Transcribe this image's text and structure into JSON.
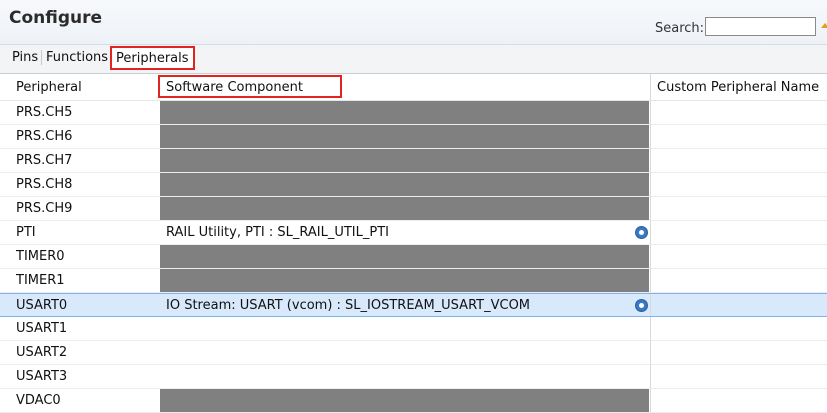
{
  "header": {
    "title": "Configure",
    "search_label": "Search:",
    "search_value": ""
  },
  "tabs": [
    {
      "label": "Pins",
      "active": false
    },
    {
      "label": "Functions",
      "active": false
    },
    {
      "label": "Peripherals",
      "active": true
    }
  ],
  "table": {
    "columns": [
      "Peripheral",
      "Software Component",
      "Custom Peripheral Name"
    ],
    "rows": [
      {
        "peripheral": "PRS.CH5",
        "component": "",
        "custom": "",
        "disabled": true,
        "selected": false,
        "configurable": false
      },
      {
        "peripheral": "PRS.CH6",
        "component": "",
        "custom": "",
        "disabled": true,
        "selected": false,
        "configurable": false
      },
      {
        "peripheral": "PRS.CH7",
        "component": "",
        "custom": "",
        "disabled": true,
        "selected": false,
        "configurable": false
      },
      {
        "peripheral": "PRS.CH8",
        "component": "",
        "custom": "",
        "disabled": true,
        "selected": false,
        "configurable": false
      },
      {
        "peripheral": "PRS.CH9",
        "component": "",
        "custom": "",
        "disabled": true,
        "selected": false,
        "configurable": false
      },
      {
        "peripheral": "PTI",
        "component": "RAIL Utility, PTI : SL_RAIL_UTIL_PTI",
        "custom": "",
        "disabled": false,
        "selected": false,
        "configurable": true
      },
      {
        "peripheral": "TIMER0",
        "component": "",
        "custom": "",
        "disabled": true,
        "selected": false,
        "configurable": false
      },
      {
        "peripheral": "TIMER1",
        "component": "",
        "custom": "",
        "disabled": true,
        "selected": false,
        "configurable": false
      },
      {
        "peripheral": "USART0",
        "component": "IO Stream: USART (vcom) : SL_IOSTREAM_USART_VCOM",
        "custom": "",
        "disabled": false,
        "selected": true,
        "configurable": true
      },
      {
        "peripheral": "USART1",
        "component": "",
        "custom": "",
        "disabled": false,
        "selected": false,
        "configurable": false
      },
      {
        "peripheral": "USART2",
        "component": "",
        "custom": "",
        "disabled": false,
        "selected": false,
        "configurable": false
      },
      {
        "peripheral": "USART3",
        "component": "",
        "custom": "",
        "disabled": false,
        "selected": false,
        "configurable": false
      },
      {
        "peripheral": "VDAC0",
        "component": "",
        "custom": "",
        "disabled": true,
        "selected": false,
        "configurable": false
      }
    ]
  },
  "colors": {
    "highlight_border": "#e0241f",
    "disabled_cell": "#808080",
    "selected_row": "#d8e9fb",
    "config_icon": "#3a78c4"
  }
}
